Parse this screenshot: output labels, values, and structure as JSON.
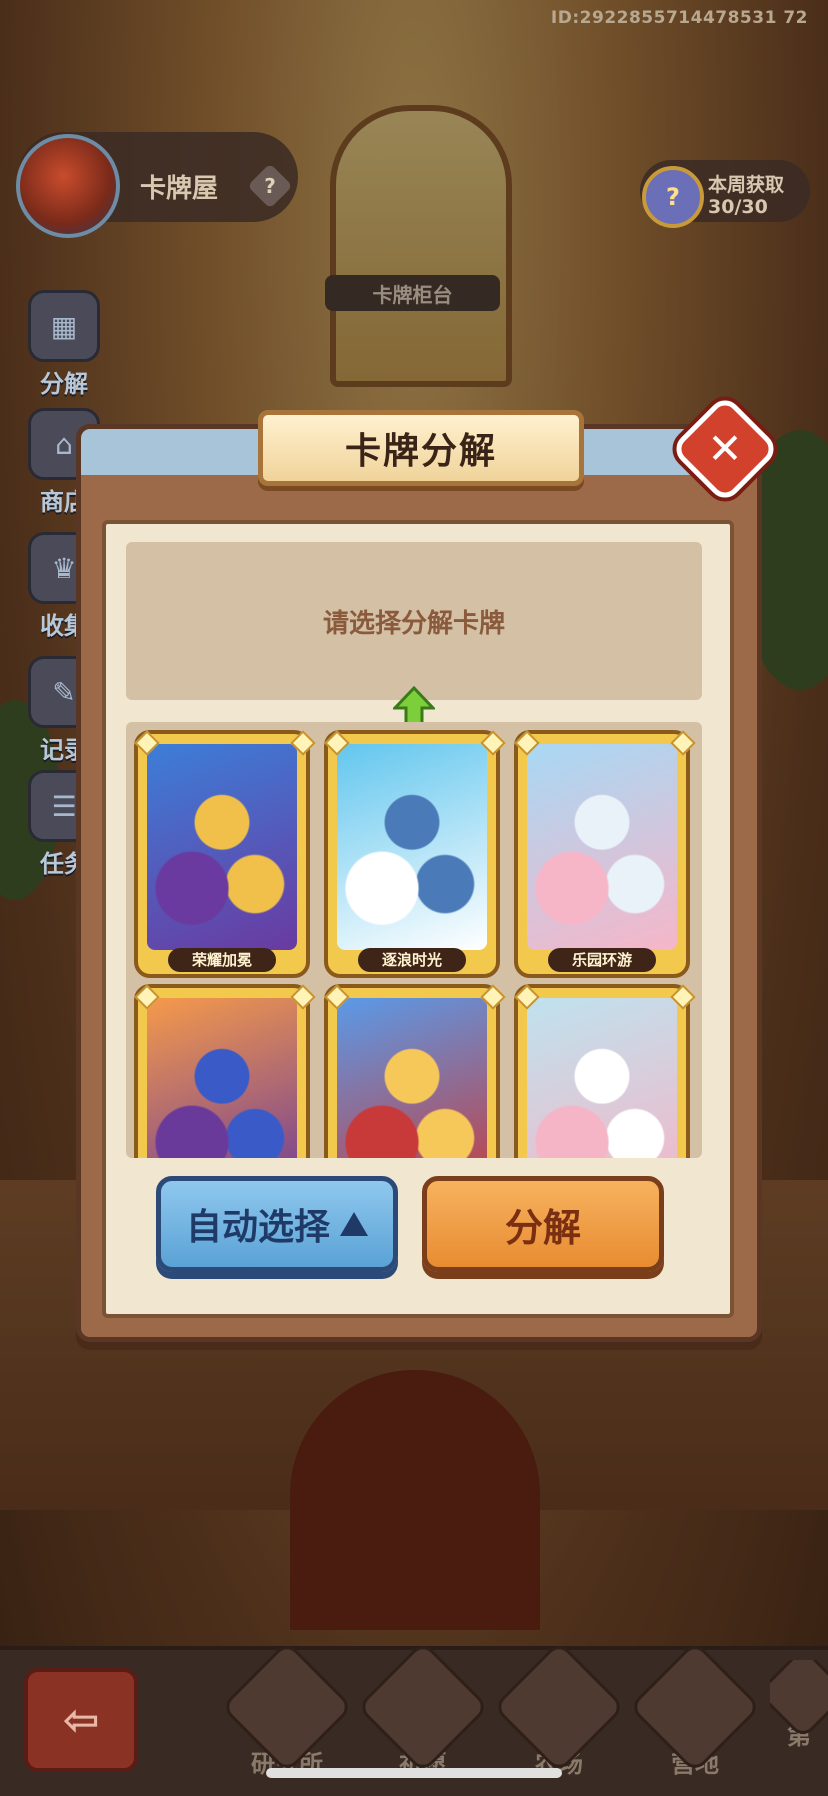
{
  "hud": {
    "uid": "ID:2922855714478531 72",
    "house_title": "卡牌屋",
    "help_icon": "?",
    "counter_label": "卡牌柜台",
    "weekly_label": "本周获取",
    "weekly_count": "30/30",
    "weekly_icon": "?"
  },
  "side_menu": [
    {
      "label": "分解",
      "icon": "box-icon"
    },
    {
      "label": "商店",
      "icon": "shop-icon"
    },
    {
      "label": "收集",
      "icon": "trophy-icon"
    },
    {
      "label": "记录",
      "icon": "record-icon"
    },
    {
      "label": "任务",
      "icon": "task-icon"
    }
  ],
  "modal": {
    "title": "卡牌分解",
    "close_icon": "✕",
    "prompt": "请选择分解卡牌",
    "cards": [
      {
        "name": "荣耀加冕",
        "colors": [
          "#3c7ed8",
          "#6a3aa0",
          "#f0c04a"
        ]
      },
      {
        "name": "逐浪时光",
        "colors": [
          "#62c6ee",
          "#ffffff",
          "#4a7ab8"
        ]
      },
      {
        "name": "乐园环游",
        "colors": [
          "#a8d8f4",
          "#f6b6c8",
          "#e8f2f8"
        ]
      },
      {
        "name": "",
        "colors": [
          "#f59a4a",
          "#6a3a9a",
          "#3a5ac8"
        ]
      },
      {
        "name": "",
        "colors": [
          "#5a9ae8",
          "#c83a3a",
          "#f6c85a"
        ]
      },
      {
        "name": "",
        "colors": [
          "#bfe2ee",
          "#f5b5c6",
          "#ffffff"
        ]
      }
    ],
    "auto_select_label": "自动选择",
    "decompose_label": "分解"
  },
  "bottom_nav": [
    {
      "label": "研究所"
    },
    {
      "label": "祈愿"
    },
    {
      "label": "农场"
    },
    {
      "label": "营地"
    },
    {
      "label": "第"
    }
  ],
  "back_icon": "⇦",
  "colors": {
    "accent_orange": "#e88c32",
    "accent_blue": "#5aa2d6",
    "close_red": "#d2412c",
    "card_gold": "#f2c94c"
  }
}
